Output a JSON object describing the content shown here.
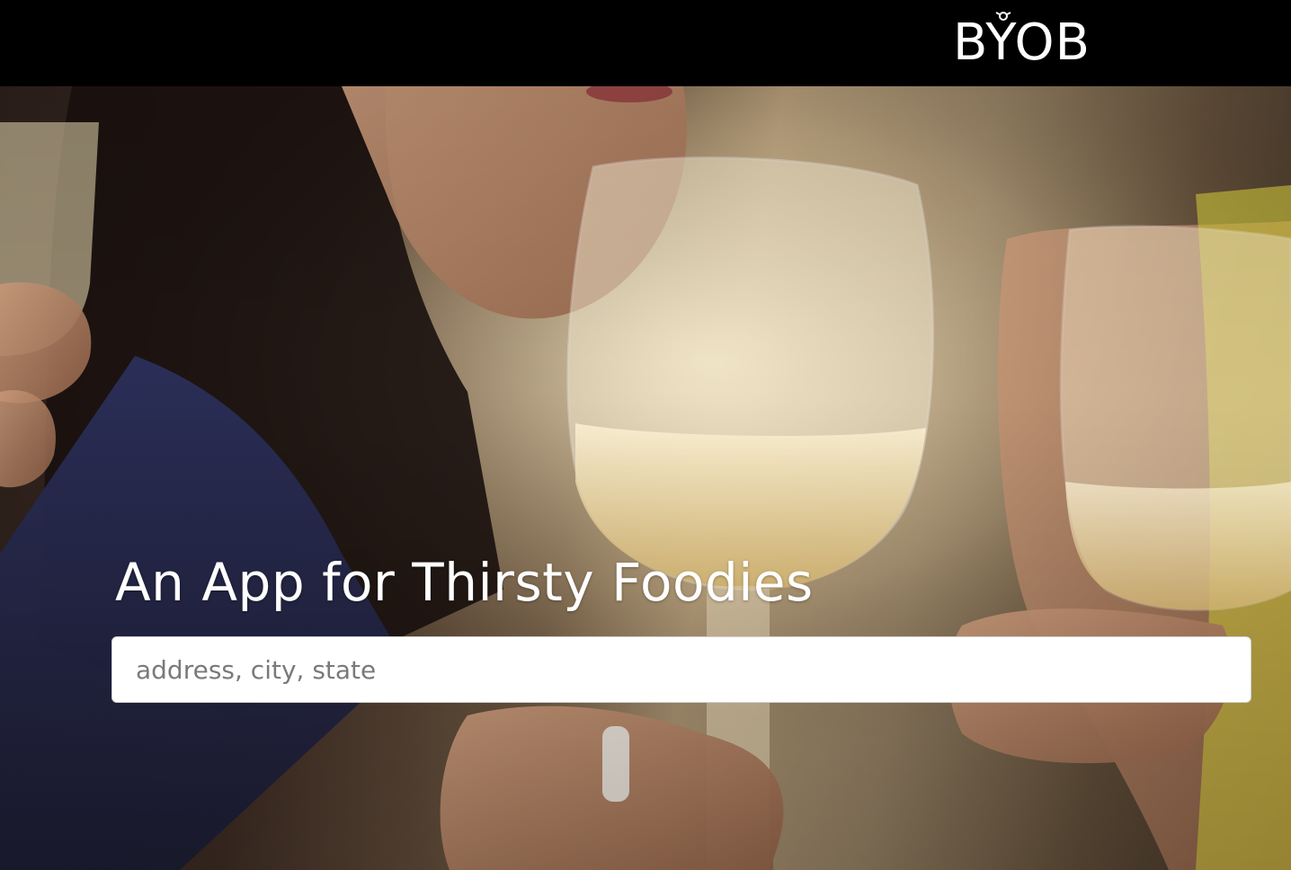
{
  "header": {
    "logo_text": "BYOB",
    "logo_icon": "corkscrew-icon"
  },
  "hero": {
    "headline": "An App for Thirsty Foodies",
    "image_subject": "people-toasting-wine-glasses-photo"
  },
  "search": {
    "placeholder": "address, city, state",
    "value": ""
  },
  "colors": {
    "header_background": "#000000",
    "headline_text": "#ffffff",
    "input_background": "#ffffff",
    "placeholder_text": "#7a7a7a"
  }
}
